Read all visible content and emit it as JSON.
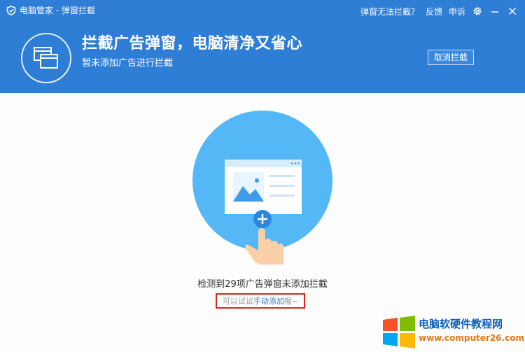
{
  "titlebar": {
    "app_title": "电脑管家 - 弹窗拦截",
    "help_link": "弹窗无法拦截？",
    "feedback_link": "反馈",
    "report_link": "申诉"
  },
  "header": {
    "headline": "拦截广告弹窗，电脑清净又省心",
    "subline": "暂未添加广告进行拦截",
    "cancel_button": "取消拦截",
    "background_color": "#2f7ed6"
  },
  "content": {
    "detect_message": "检测到29项广告弹窗未添加拦截",
    "hint_prefix": "可以试试",
    "hint_link": "手动添加",
    "hint_suffix": "喔~"
  },
  "watermark": {
    "title": "电脑软硬件教程网",
    "url": "www.computer26.com"
  }
}
